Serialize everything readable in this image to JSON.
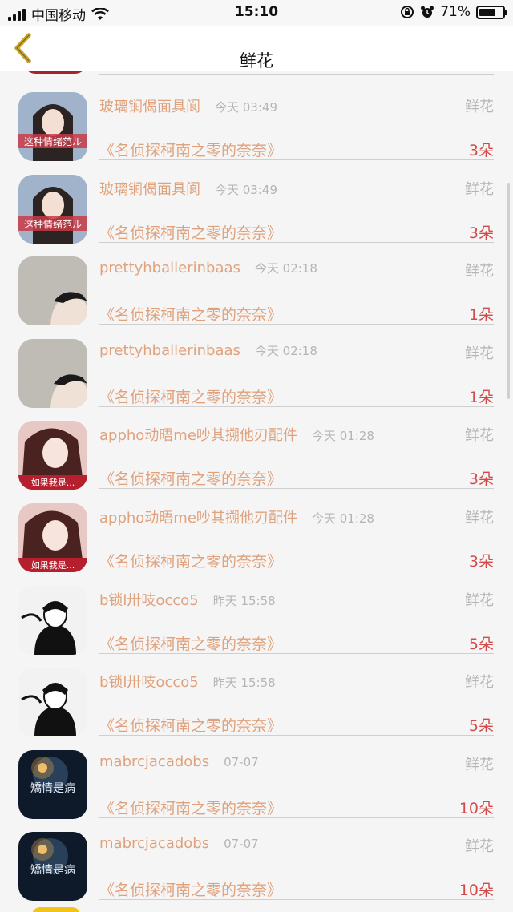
{
  "status_bar": {
    "carrier": "中国移动",
    "time": "15:10",
    "battery_percent": "71%"
  },
  "nav": {
    "title": "鲜花"
  },
  "rows": [
    {
      "name": "玻璃锏偈面具阆",
      "time": "今天 03:49",
      "type": "鲜花",
      "book": "《名侦探柯南之零的奈奈》",
      "count": "3朵",
      "avatar_text": "这种情绪范ル"
    },
    {
      "name": "玻璃锏偈面具阆",
      "time": "今天 03:49",
      "type": "鲜花",
      "book": "《名侦探柯南之零的奈奈》",
      "count": "3朵",
      "avatar_text": "这种情绪范ル"
    },
    {
      "name": "prettyhballerinbaas",
      "time": "今天 02:18",
      "type": "鲜花",
      "book": "《名侦探柯南之零的奈奈》",
      "count": "1朵",
      "avatar_text": ""
    },
    {
      "name": "prettyhballerinbaas",
      "time": "今天 02:18",
      "type": "鲜花",
      "book": "《名侦探柯南之零的奈奈》",
      "count": "1朵",
      "avatar_text": ""
    },
    {
      "name": "appho动晤me吵其搠他刃配件",
      "time": "今天 01:28",
      "type": "鲜花",
      "book": "《名侦探柯南之零的奈奈》",
      "count": "3朵",
      "avatar_text": "如果我是..."
    },
    {
      "name": "appho动晤me吵其搠他刃配件",
      "time": "今天 01:28",
      "type": "鲜花",
      "book": "《名侦探柯南之零的奈奈》",
      "count": "3朵",
      "avatar_text": "如果我是..."
    },
    {
      "name": "b锁l卅吱occo5",
      "time": "昨天 15:58",
      "type": "鲜花",
      "book": "《名侦探柯南之零的奈奈》",
      "count": "5朵",
      "avatar_text": ""
    },
    {
      "name": "b锁l卅吱occo5",
      "time": "昨天 15:58",
      "type": "鲜花",
      "book": "《名侦探柯南之零的奈奈》",
      "count": "5朵",
      "avatar_text": ""
    },
    {
      "name": "mabrcjacadobs",
      "time": "07-07",
      "type": "鲜花",
      "book": "《名侦探柯南之零的奈奈》",
      "count": "10朵",
      "avatar_text": "矯情是病"
    },
    {
      "name": "mabrcjacadobs",
      "time": "07-07",
      "type": "鲜花",
      "book": "《名侦探柯南之零的奈奈》",
      "count": "10朵",
      "avatar_text": "矯情是病"
    }
  ],
  "icons": {
    "back": "chevron-left-icon",
    "wifi": "wifi-icon",
    "lock_rotation": "orientation-lock-icon",
    "alarm": "alarm-icon"
  },
  "colors": {
    "name": "#e0a27c",
    "count": "#d24a4a",
    "meta": "#b5b5b5",
    "back_chevron": "#c9a32a"
  }
}
